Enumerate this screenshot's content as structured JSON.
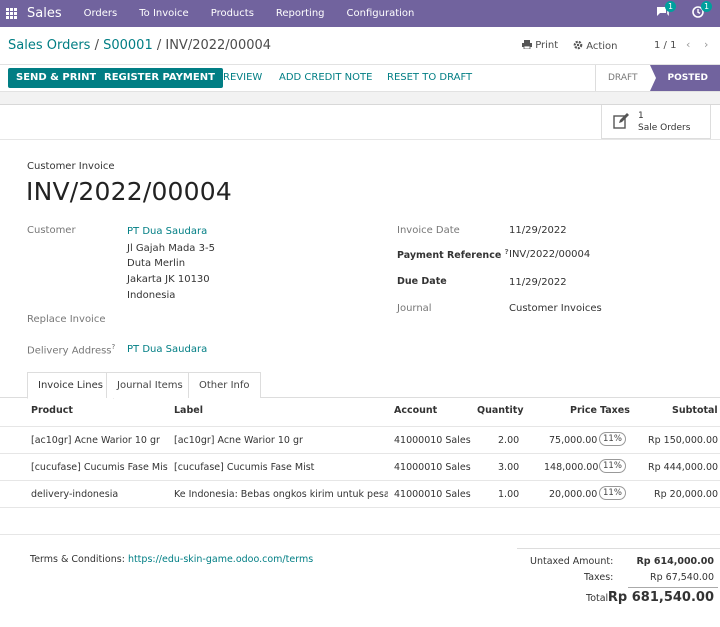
{
  "navbar": {
    "brand": "Sales",
    "menu": [
      "Orders",
      "To Invoice",
      "Products",
      "Reporting",
      "Configuration"
    ],
    "chat_count": "1",
    "activity_count": "1"
  },
  "control": {
    "crumb1": "Sales Orders",
    "crumb2": "S00001",
    "crumb3": "INV/2022/00004",
    "sep": " / ",
    "print": "Print",
    "action": "Action",
    "pager": "1 / 1"
  },
  "buttons": {
    "send_print": "SEND & PRINT",
    "register_payment": "REGISTER PAYMENT",
    "preview": "PREVIEW",
    "add_credit_note": "ADD CREDIT NOTE",
    "reset_to_draft": "RESET TO DRAFT"
  },
  "status": {
    "draft": "DRAFT",
    "posted": "POSTED"
  },
  "smart_button": {
    "count": "1",
    "label": "Sale Orders"
  },
  "invoice": {
    "type": "Customer Invoice",
    "name": "INV/2022/00004",
    "customer_label": "Customer",
    "customer_name": "PT Dua Saudara",
    "address": [
      "Jl Gajah Mada 3-5",
      "Duta Merlin",
      "Jakarta JK 10130",
      "Indonesia"
    ],
    "replace_invoice_label": "Replace Invoice",
    "delivery_label": "Delivery Address",
    "delivery_value": "PT Dua Saudara",
    "invoice_date_label": "Invoice Date",
    "invoice_date": "11/29/2022",
    "payment_ref_label": "Payment Reference",
    "payment_ref": "INV/2022/00004",
    "due_date_label": "Due Date",
    "due_date": "11/29/2022",
    "journal_label": "Journal",
    "journal": "Customer Invoices",
    "help": "?"
  },
  "tabs": [
    "Invoice Lines",
    "Journal Items",
    "Other Info"
  ],
  "table": {
    "headers": {
      "product": "Product",
      "label": "Label",
      "account": "Account",
      "quantity": "Quantity",
      "price": "Price",
      "taxes": "Taxes",
      "subtotal": "Subtotal"
    },
    "rows": [
      {
        "product": "[ac10gr] Acne Warior 10 gr",
        "label": "[ac10gr] Acne Warior 10 gr",
        "account": "41000010 Sales",
        "quantity": "2.00",
        "price": "75,000.00",
        "tax": "11%",
        "subtotal": "Rp 150,000.00"
      },
      {
        "product": "[cucufase] Cucumis Fase Mist",
        "label": "[cucufase] Cucumis Fase Mist",
        "account": "41000010 Sales",
        "quantity": "3.00",
        "price": "148,000.00",
        "tax": "11%",
        "subtotal": "Rp 444,000.00"
      },
      {
        "product": "delivery-indonesia",
        "label": "Ke Indonesia: Bebas ongkos kirim untuk pesa...",
        "account": "41000010 Sales",
        "quantity": "1.00",
        "price": "20,000.00",
        "tax": "11%",
        "subtotal": "Rp 20,000.00"
      }
    ]
  },
  "terms": {
    "label": "Terms & Conditions: ",
    "url": "https://edu-skin-game.odoo.com/terms"
  },
  "totals": {
    "untaxed_label": "Untaxed Amount:",
    "untaxed": "Rp 614,000.00",
    "taxes_label": "Taxes:",
    "taxes": "Rp 67,540.00",
    "total_label": "Total:",
    "total": "Rp 681,540.00"
  },
  "colors": {
    "brand": "#71639e",
    "primary": "#017e84"
  }
}
